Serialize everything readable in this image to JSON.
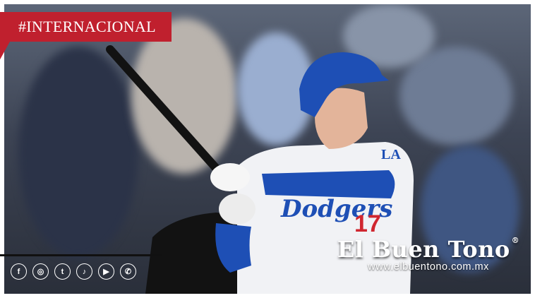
{
  "category_tag": "#INTERNACIONAL",
  "social_icons": [
    "facebook-icon",
    "instagram-icon",
    "twitter-icon",
    "tiktok-icon",
    "youtube-icon",
    "whatsapp-icon"
  ],
  "watermark": {
    "name": "El Buen Tono",
    "registered": "®",
    "url": "www.elbuentono.com.mx"
  },
  "jersey": {
    "script": "Dodgers",
    "number": "17",
    "sleeve_logo": "LA"
  },
  "colors": {
    "tag_red": "#c0202e",
    "dodger_blue": "#1e4fb5"
  }
}
